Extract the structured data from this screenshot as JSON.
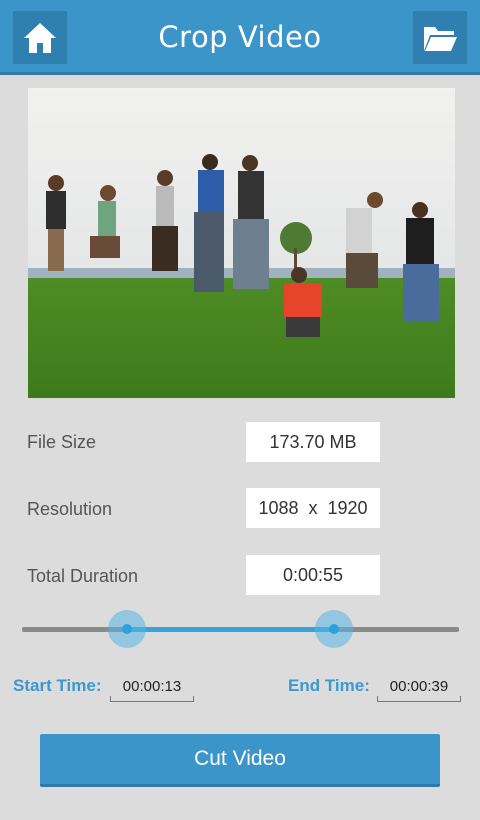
{
  "header": {
    "title": "Crop Video",
    "home_icon": "home-icon",
    "folder_icon": "folder-icon",
    "color": "#3b95c8"
  },
  "info": {
    "file_size_label": "File Size",
    "file_size_value": "173.70 MB",
    "resolution_label": "Resolution",
    "resolution_value": "1088  x  1920",
    "duration_label": "Total Duration",
    "duration_value": "0:00:55"
  },
  "trim": {
    "start_label": "Start Time:",
    "start_value": "00:00:13",
    "end_label": "End Time:",
    "end_value": "00:00:39",
    "accent": "#37a3da"
  },
  "actions": {
    "cut_label": "Cut Video"
  }
}
